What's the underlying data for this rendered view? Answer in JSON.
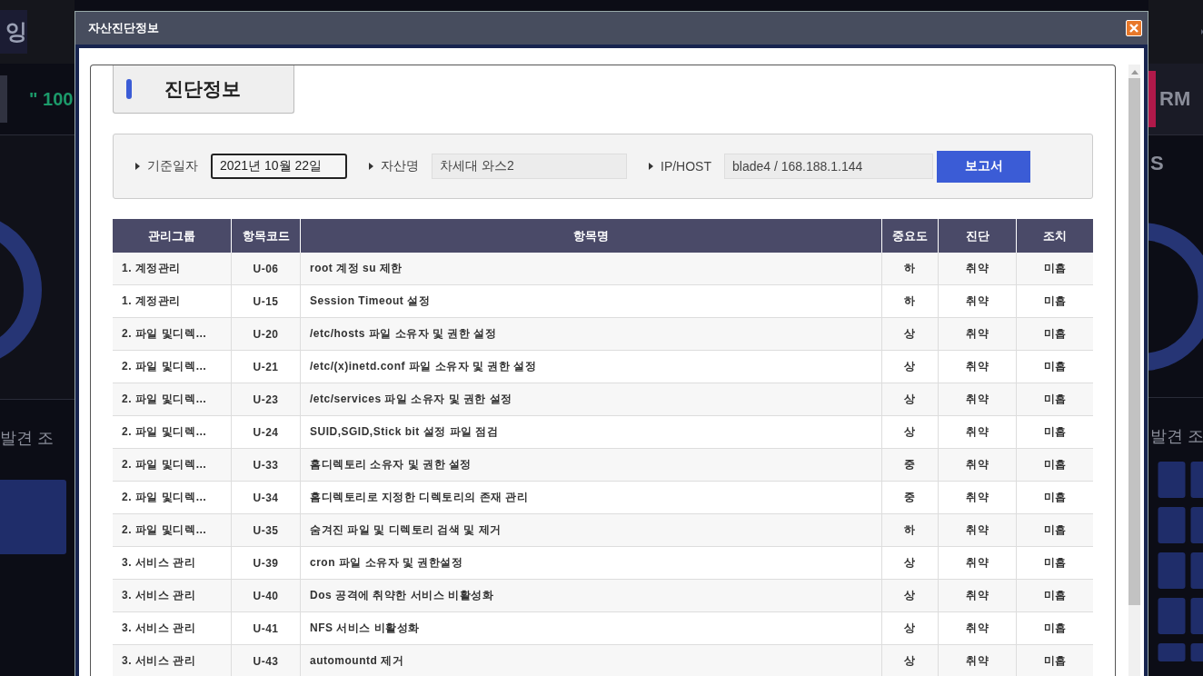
{
  "background": {
    "left_tab": "잉",
    "left_stat": "\" 100",
    "left_caption": "발견 조",
    "right_stat": "RM",
    "right_label": "S",
    "right_caption": "발견 조"
  },
  "dialog": {
    "title": "자산진단정보",
    "section_title": "진단정보",
    "filters": [
      {
        "label": "기준일자",
        "value": "2021년 10월 22일",
        "focused": true
      },
      {
        "label": "자산명",
        "value": "차세대 와스2",
        "focused": false
      },
      {
        "label": "IP/HOST",
        "value": "blade4 / 168.188.1.144",
        "focused": false
      }
    ],
    "report_button": "보고서",
    "table": {
      "columns": [
        "관리그룹",
        "항목코드",
        "항목명",
        "중요도",
        "진단",
        "조치"
      ],
      "rows": [
        [
          "1. 계정관리",
          "U-06",
          "root 계정 su 제한",
          "하",
          "취약",
          "미흡"
        ],
        [
          "1. 계정관리",
          "U-15",
          "Session Timeout 설정",
          "하",
          "취약",
          "미흡"
        ],
        [
          "2. 파일 및디렉…",
          "U-20",
          "/etc/hosts 파일 소유자 및 권한 설정",
          "상",
          "취약",
          "미흡"
        ],
        [
          "2. 파일 및디렉…",
          "U-21",
          "/etc/(x)inetd.conf 파일 소유자 및 권한 설정",
          "상",
          "취약",
          "미흡"
        ],
        [
          "2. 파일 및디렉…",
          "U-23",
          "/etc/services 파일 소유자 및 권한 설정",
          "상",
          "취약",
          "미흡"
        ],
        [
          "2. 파일 및디렉…",
          "U-24",
          "SUID,SGID,Stick bit 설정 파일 점검",
          "상",
          "취약",
          "미흡"
        ],
        [
          "2. 파일 및디렉…",
          "U-33",
          "홈디렉토리 소유자 및 권한 설정",
          "중",
          "취약",
          "미흡"
        ],
        [
          "2. 파일 및디렉…",
          "U-34",
          "홈디렉토리로 지정한 디렉토리의 존재 관리",
          "중",
          "취약",
          "미흡"
        ],
        [
          "2. 파일 및디렉…",
          "U-35",
          "숨겨진 파일 및 디렉토리 검색 및 제거",
          "하",
          "취약",
          "미흡"
        ],
        [
          "3. 서비스 관리",
          "U-39",
          "cron 파일 소유자 및 권한설정",
          "상",
          "취약",
          "미흡"
        ],
        [
          "3. 서비스 관리",
          "U-40",
          "Dos 공격에 취약한 서비스 비활성화",
          "상",
          "취약",
          "미흡"
        ],
        [
          "3. 서비스 관리",
          "U-41",
          "NFS 서비스 비활성화",
          "상",
          "취약",
          "미흡"
        ],
        [
          "3. 서비스 관리",
          "U-43",
          "automountd 제거",
          "상",
          "취약",
          "미흡"
        ]
      ]
    }
  }
}
